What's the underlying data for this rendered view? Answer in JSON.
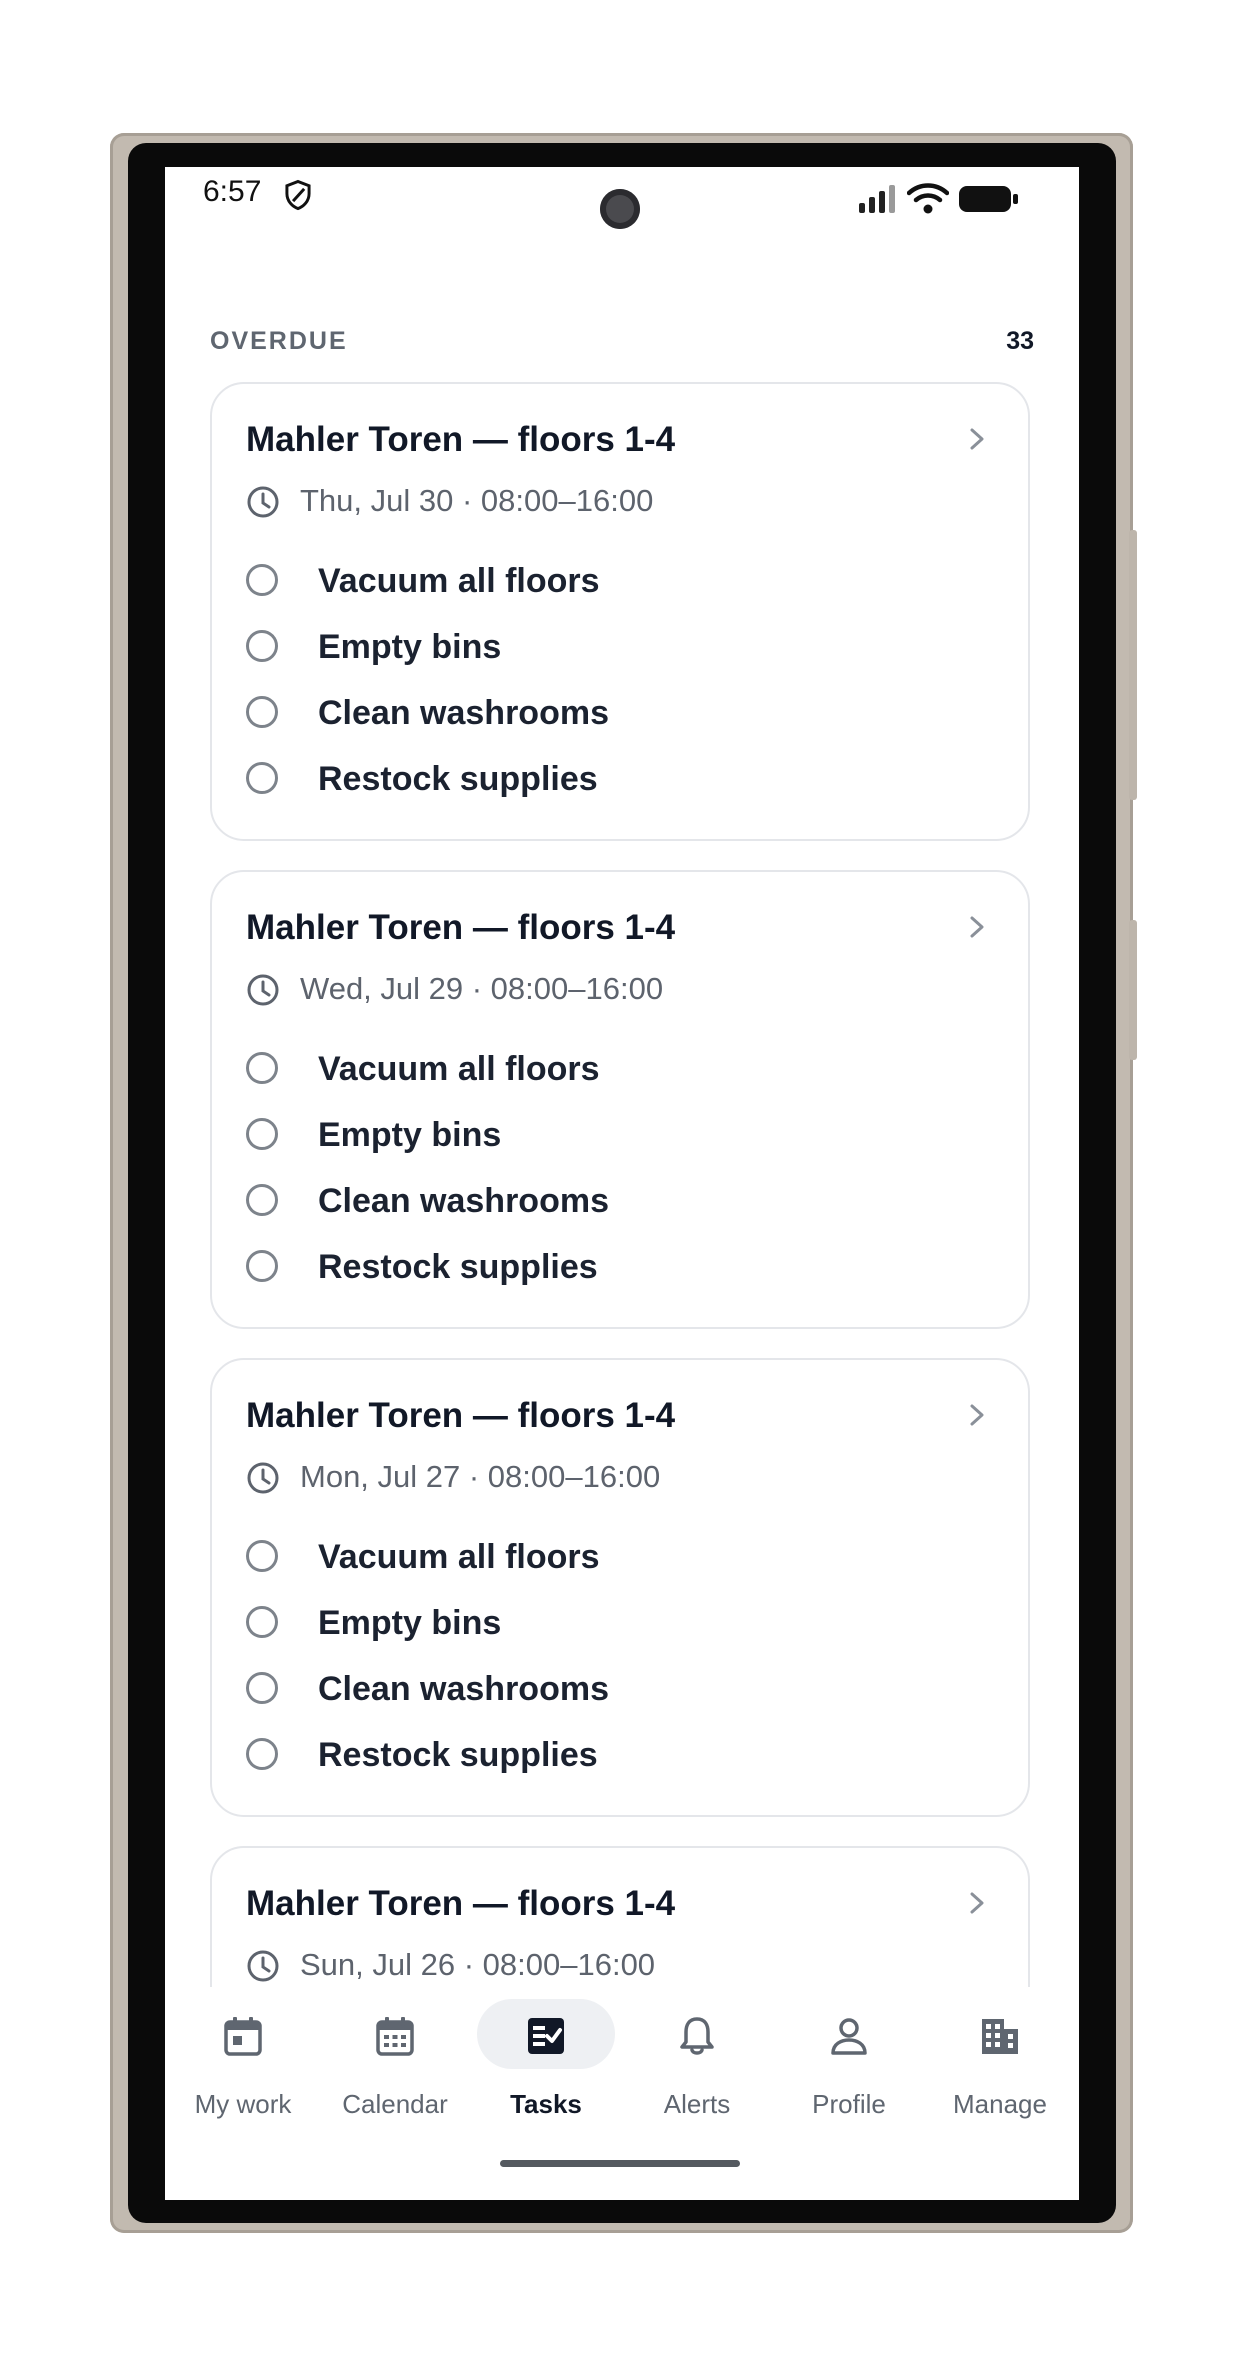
{
  "status_bar": {
    "time": "6:57",
    "shield_icon": "shield-icon",
    "signal_icon": "signal-icon",
    "wifi_icon": "wifi-icon",
    "battery_icon": "battery-icon"
  },
  "section": {
    "title": "OVERDUE",
    "count": "33"
  },
  "cards": [
    {
      "title": "Mahler Toren — floors 1-4",
      "time": "Thu, Jul 30 · 08:00–16:00",
      "tasks": [
        "Vacuum all floors",
        "Empty bins",
        "Clean washrooms",
        "Restock supplies"
      ]
    },
    {
      "title": "Mahler Toren — floors 1-4",
      "time": "Wed, Jul 29 · 08:00–16:00",
      "tasks": [
        "Vacuum all floors",
        "Empty bins",
        "Clean washrooms",
        "Restock supplies"
      ]
    },
    {
      "title": "Mahler Toren — floors 1-4",
      "time": "Mon, Jul 27 · 08:00–16:00",
      "tasks": [
        "Vacuum all floors",
        "Empty bins",
        "Clean washrooms",
        "Restock supplies"
      ]
    },
    {
      "title": "Mahler Toren — floors 1-4",
      "time": "Sun, Jul 26 · 08:00–16:00",
      "tasks": []
    }
  ],
  "nav": [
    {
      "label": "My work",
      "icon": "calendar-day-icon",
      "active": false
    },
    {
      "label": "Calendar",
      "icon": "calendar-grid-icon",
      "active": false
    },
    {
      "label": "Tasks",
      "icon": "task-checklist-icon",
      "active": true
    },
    {
      "label": "Alerts",
      "icon": "bell-icon",
      "active": false
    },
    {
      "label": "Profile",
      "icon": "person-icon",
      "active": false
    },
    {
      "label": "Manage",
      "icon": "building-icon",
      "active": false
    }
  ],
  "colors": {
    "text_primary": "#111827",
    "text_secondary": "#5f6670",
    "card_border": "#e4e6ea",
    "active_pill": "#eef0f3"
  }
}
